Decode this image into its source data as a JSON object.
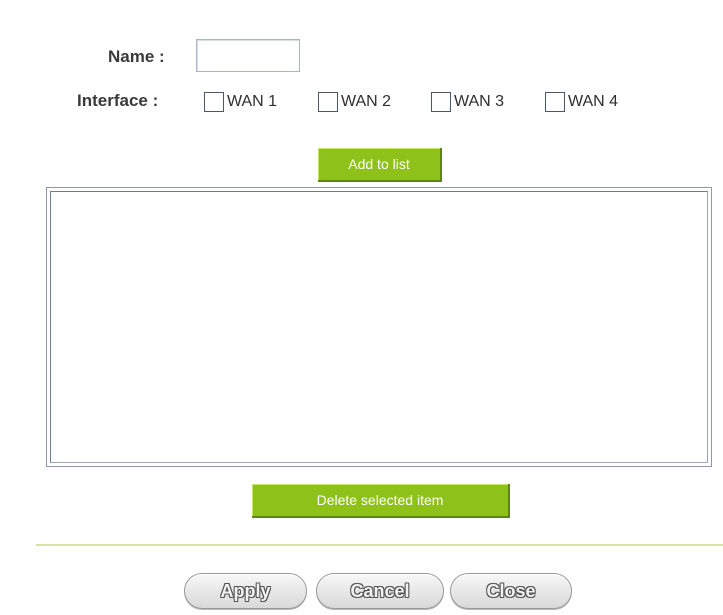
{
  "form": {
    "name_label": "Name :",
    "name_value": "",
    "interface_label": "Interface :",
    "interfaces": [
      {
        "label": "WAN 1",
        "checked": false
      },
      {
        "label": "WAN 2",
        "checked": false
      },
      {
        "label": "WAN 3",
        "checked": false
      },
      {
        "label": "WAN 4",
        "checked": false
      }
    ],
    "add_button": "Add to list",
    "list_items": [],
    "delete_button": "Delete selected item"
  },
  "footer": {
    "apply": "Apply",
    "cancel": "Cancel",
    "close": "Close"
  },
  "colors": {
    "accent_green": "#8ec21a",
    "divider": "#d7e3a6"
  }
}
